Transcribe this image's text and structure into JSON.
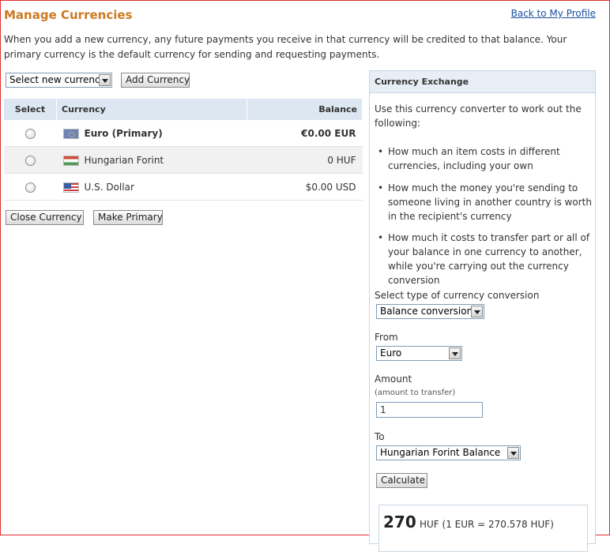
{
  "header": {
    "title": "Manage Currencies",
    "back_link": "Back to My Profile",
    "intro": "When you add a new currency, any future payments you receive in that currency will be credited to that balance. Your primary currency is the default currency for sending and requesting payments."
  },
  "add_currency": {
    "select_value": "Select new currency",
    "button_label": "Add Currency"
  },
  "table": {
    "headers": {
      "select": "Select",
      "currency": "Currency",
      "balance": "Balance"
    },
    "rows": [
      {
        "name": "Euro (Primary)",
        "balance": "€0.00 EUR",
        "flag": "eu-flag"
      },
      {
        "name": "Hungarian Forint",
        "balance": "0 HUF",
        "flag": "hu-flag"
      },
      {
        "name": "U.S. Dollar",
        "balance": "$0.00 USD",
        "flag": "us-flag"
      }
    ]
  },
  "actions": {
    "close": "Close Currency",
    "primary": "Make Primary"
  },
  "exchange": {
    "title": "Currency Exchange",
    "intro": "Use this currency converter to work out the following:",
    "bullets": [
      "How much an item costs in different currencies, including your own",
      "How much the money you're sending to someone living in another country is worth in the recipient's currency",
      "How much it costs to transfer part or all of your balance in one currency to another, while you're carrying out the currency conversion"
    ],
    "type_label": "Select type of currency conversion",
    "type_value": "Balance conversion",
    "from_label": "From",
    "from_value": "Euro",
    "amount_label": "Amount",
    "amount_hint": "(amount to transfer)",
    "amount_value": "1",
    "to_label": "To",
    "to_value": "Hungarian Forint Balance",
    "calculate_label": "Calculate",
    "result_amount": "270",
    "result_text": "HUF (1 EUR = 270.578  HUF)"
  },
  "colors": {
    "title": "#cc7a22",
    "link": "#1a4fa0",
    "header_bg": "#dde7f1"
  }
}
